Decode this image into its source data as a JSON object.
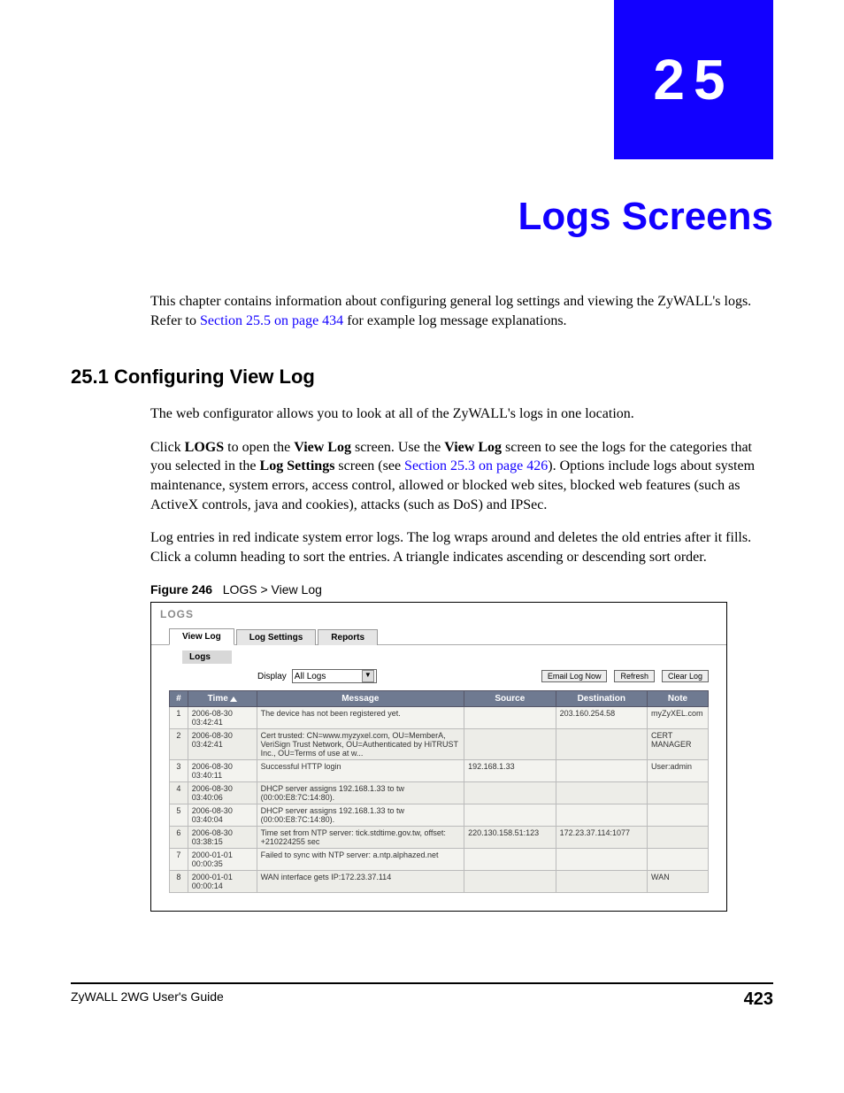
{
  "chapter": {
    "number": "25",
    "title": "Logs Screens"
  },
  "intro": {
    "part1": "This chapter contains information about configuring general log settings and viewing the ZyWALL's logs. Refer to ",
    "link": "Section 25.5 on page 434",
    "part2": " for example log message explanations."
  },
  "section": {
    "heading": "25.1  Configuring View Log",
    "p1": "The web configurator allows you to look at all of the ZyWALL's logs in one location.",
    "p2a": "Click ",
    "p2b_bold": "LOGS",
    "p2c": " to open the ",
    "p2d_bold": "View Log",
    "p2e": " screen. Use the ",
    "p2f_bold": "View Log",
    "p2g": " screen to see the logs for the categories that you selected in the ",
    "p2h_bold": "Log Settings",
    "p2i": " screen (see ",
    "p2_link": "Section 25.3 on page 426",
    "p2j": "). Options include logs about system maintenance, system errors, access control, allowed or blocked web sites, blocked web features (such as ActiveX controls, java and cookies), attacks (such as DoS) and IPSec.",
    "p3": "Log entries in red indicate system error logs. The log wraps around and deletes the old entries after it fills. Click a column heading to sort the entries. A triangle indicates ascending or descending sort order."
  },
  "figure": {
    "label": "Figure 246",
    "caption": "LOGS > View Log"
  },
  "screenshot": {
    "header": "LOGS",
    "tabs": [
      "View Log",
      "Log Settings",
      "Reports"
    ],
    "subhead": "Logs",
    "display_label": "Display",
    "display_value": "All Logs",
    "buttons": {
      "email": "Email Log Now",
      "refresh": "Refresh",
      "clear": "Clear Log"
    },
    "columns": {
      "num": "#",
      "time": "Time",
      "msg": "Message",
      "src": "Source",
      "dst": "Destination",
      "note": "Note"
    },
    "rows": [
      {
        "n": "1",
        "time": "2006-08-30 03:42:41",
        "msg": "The device has not been registered yet.",
        "src": "",
        "dst": "203.160.254.58",
        "note": "myZyXEL.com"
      },
      {
        "n": "2",
        "time": "2006-08-30 03:42:41",
        "msg": "Cert trusted: CN=www.myzyxel.com, OU=MemberA, VeriSign Trust Network, OU=Authenticated by HiTRUST Inc., OU=Terms of use at w...",
        "src": "",
        "dst": "",
        "note": "CERT MANAGER"
      },
      {
        "n": "3",
        "time": "2006-08-30 03:40:11",
        "msg": "Successful HTTP login",
        "src": "192.168.1.33",
        "dst": "",
        "note": "User:admin"
      },
      {
        "n": "4",
        "time": "2006-08-30 03:40:06",
        "msg": "DHCP server assigns 192.168.1.33 to tw (00:00:E8:7C:14:80).",
        "src": "",
        "dst": "",
        "note": ""
      },
      {
        "n": "5",
        "time": "2006-08-30 03:40:04",
        "msg": "DHCP server assigns 192.168.1.33 to tw (00:00:E8:7C:14:80).",
        "src": "",
        "dst": "",
        "note": ""
      },
      {
        "n": "6",
        "time": "2006-08-30 03:38:15",
        "msg": "Time set from NTP server: tick.stdtime.gov.tw, offset: +210224255 sec",
        "src": "220.130.158.51:123",
        "dst": "172.23.37.114:1077",
        "note": ""
      },
      {
        "n": "7",
        "time": "2000-01-01 00:00:35",
        "msg": "Failed to sync with NTP server: a.ntp.alphazed.net",
        "src": "",
        "dst": "",
        "note": ""
      },
      {
        "n": "8",
        "time": "2000-01-01 00:00:14",
        "msg": "WAN interface gets IP:172.23.37.114",
        "src": "",
        "dst": "",
        "note": "WAN"
      }
    ]
  },
  "footer": {
    "guide": "ZyWALL 2WG User's Guide",
    "page": "423"
  }
}
